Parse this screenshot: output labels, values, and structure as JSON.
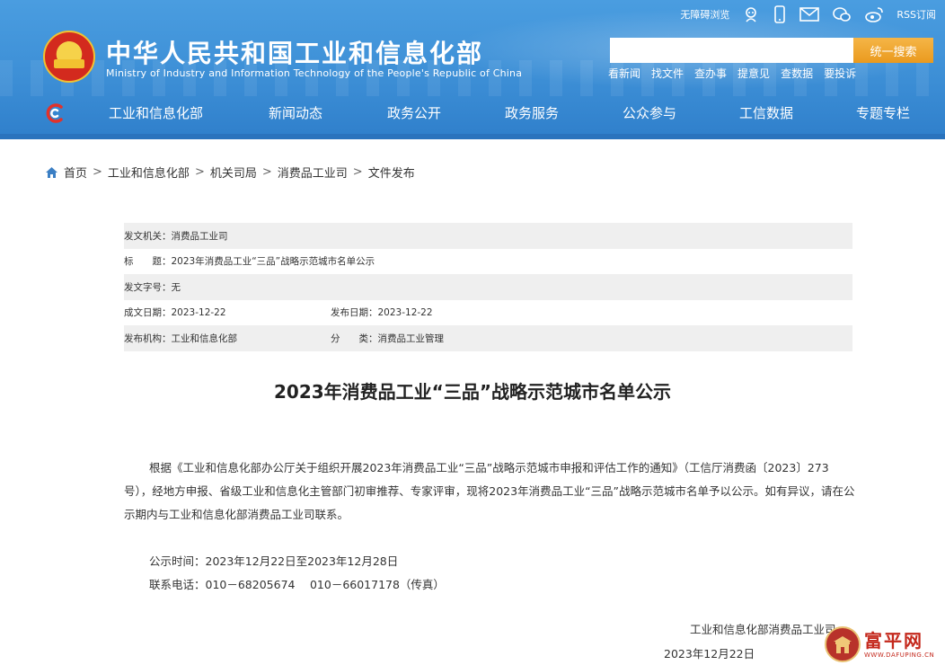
{
  "header": {
    "site_title": "中华人民共和国工业和信息化部",
    "site_subtitle": "Ministry of Industry and Information Technology of the People's Republic of China",
    "top_links": {
      "accessibility": "无障碍浏览",
      "rss": "RSS订阅"
    },
    "search": {
      "placeholder": "",
      "button_label": "统一搜索"
    },
    "quick_links": [
      "看新闻",
      "找文件",
      "查办事",
      "提意见",
      "查数据",
      "要投诉"
    ],
    "colors": {
      "header_blue": "#3d8fd6",
      "search_orange": "#ea9a1e"
    }
  },
  "nav": {
    "items": [
      "工业和信息化部",
      "新闻动态",
      "政务公开",
      "政务服务",
      "公众参与",
      "工信数据",
      "专题专栏"
    ]
  },
  "breadcrumb": {
    "items": [
      "首页",
      "工业和信息化部",
      "机关司局",
      "消费品工业司",
      "文件发布"
    ],
    "separator": ">"
  },
  "metadata": {
    "issuer": "发文机关：消费品工业司",
    "title": "标　　题：2023年消费品工业“三品”战略示范城市名单公示",
    "doc_number": "发文字号：无",
    "created_date": "成文日期：2023-12-22",
    "published_date": "发布日期：2023-12-22",
    "publisher": "发布机构：工业和信息化部",
    "category": "分　　类：消费品工业管理"
  },
  "article": {
    "title": "2023年消费品工业“三品”战略示范城市名单公示",
    "paragraph": "根据《工业和信息化部办公厅关于组织开展2023年消费品工业“三品”战略示范城市申报和评估工作的通知》（工信厅消费函〔2023〕273号），经地方申报、省级工业和信息化主管部门初审推荐、专家评审，现将2023年消费品工业“三品”战略示范城市名单予以公示。如有异议，请在公示期内与工业和信息化部消费品工业司联系。",
    "notice_period": "公示时间：2023年12月22日至2023年12月28日",
    "contact": "联系电话：010－68205674　 010－66017178（传真）",
    "signature_org": "工业和信息化部消费品工业司",
    "signature_date": "2023年12月22日"
  },
  "watermark": {
    "name": "富平网",
    "url": "WWW.DAFUPING.CN"
  }
}
